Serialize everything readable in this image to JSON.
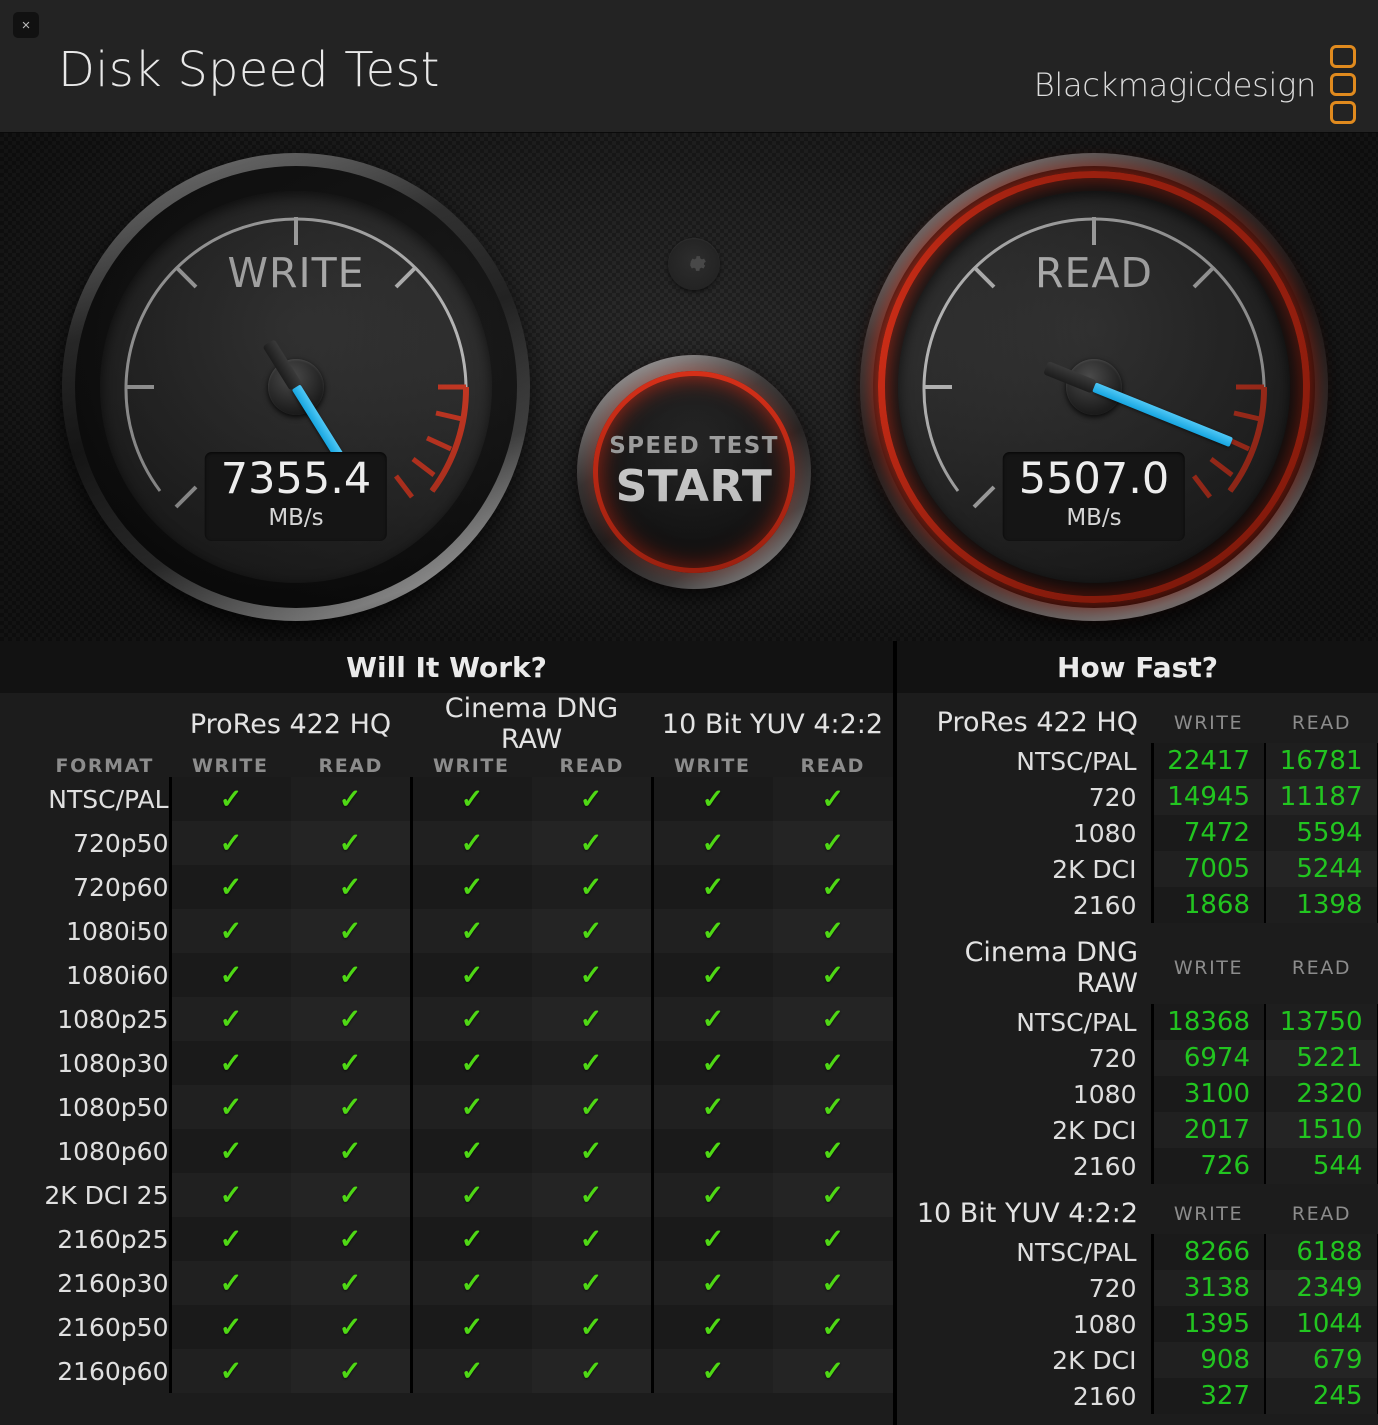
{
  "window": {
    "close_label": "×",
    "title": "Disk Speed Test",
    "brand": "Blackmagicdesign"
  },
  "gauges": {
    "write": {
      "label": "WRITE",
      "value": "7355.4",
      "unit": "MB/s",
      "angle_deg": 58
    },
    "read": {
      "label": "READ",
      "value": "5507.0",
      "unit": "MB/s",
      "angle_deg": 22
    },
    "start_button": {
      "line1": "SPEED TEST",
      "line2": "START"
    },
    "settings_icon": "gear-icon"
  },
  "will_it_work": {
    "title": "Will It Work?",
    "format_header": "FORMAT",
    "groups": [
      "ProRes 422 HQ",
      "Cinema DNG RAW",
      "10 Bit YUV 4:2:2"
    ],
    "sub_headers": [
      "WRITE",
      "READ"
    ],
    "check_glyph": "✓",
    "rows": [
      {
        "format": "NTSC/PAL",
        "results": [
          true,
          true,
          true,
          true,
          true,
          true
        ]
      },
      {
        "format": "720p50",
        "results": [
          true,
          true,
          true,
          true,
          true,
          true
        ]
      },
      {
        "format": "720p60",
        "results": [
          true,
          true,
          true,
          true,
          true,
          true
        ]
      },
      {
        "format": "1080i50",
        "results": [
          true,
          true,
          true,
          true,
          true,
          true
        ]
      },
      {
        "format": "1080i60",
        "results": [
          true,
          true,
          true,
          true,
          true,
          true
        ]
      },
      {
        "format": "1080p25",
        "results": [
          true,
          true,
          true,
          true,
          true,
          true
        ]
      },
      {
        "format": "1080p30",
        "results": [
          true,
          true,
          true,
          true,
          true,
          true
        ]
      },
      {
        "format": "1080p50",
        "results": [
          true,
          true,
          true,
          true,
          true,
          true
        ]
      },
      {
        "format": "1080p60",
        "results": [
          true,
          true,
          true,
          true,
          true,
          true
        ]
      },
      {
        "format": "2K DCI 25",
        "results": [
          true,
          true,
          true,
          true,
          true,
          true
        ]
      },
      {
        "format": "2160p25",
        "results": [
          true,
          true,
          true,
          true,
          true,
          true
        ]
      },
      {
        "format": "2160p30",
        "results": [
          true,
          true,
          true,
          true,
          true,
          true
        ]
      },
      {
        "format": "2160p50",
        "results": [
          true,
          true,
          true,
          true,
          true,
          true
        ]
      },
      {
        "format": "2160p60",
        "results": [
          true,
          true,
          true,
          true,
          true,
          true
        ]
      }
    ]
  },
  "how_fast": {
    "title": "How Fast?",
    "sub_headers": [
      "WRITE",
      "READ"
    ],
    "sections": [
      {
        "name": "ProRes 422 HQ",
        "rows": [
          {
            "label": "NTSC/PAL",
            "write": "22417",
            "read": "16781"
          },
          {
            "label": "720",
            "write": "14945",
            "read": "11187"
          },
          {
            "label": "1080",
            "write": "7472",
            "read": "5594"
          },
          {
            "label": "2K DCI",
            "write": "7005",
            "read": "5244"
          },
          {
            "label": "2160",
            "write": "1868",
            "read": "1398"
          }
        ]
      },
      {
        "name": "Cinema DNG RAW",
        "rows": [
          {
            "label": "NTSC/PAL",
            "write": "18368",
            "read": "13750"
          },
          {
            "label": "720",
            "write": "6974",
            "read": "5221"
          },
          {
            "label": "1080",
            "write": "3100",
            "read": "2320"
          },
          {
            "label": "2K DCI",
            "write": "2017",
            "read": "1510"
          },
          {
            "label": "2160",
            "write": "726",
            "read": "544"
          }
        ]
      },
      {
        "name": "10 Bit YUV 4:2:2",
        "rows": [
          {
            "label": "NTSC/PAL",
            "write": "8266",
            "read": "6188"
          },
          {
            "label": "720",
            "write": "3138",
            "read": "2349"
          },
          {
            "label": "1080",
            "write": "1395",
            "read": "1044"
          },
          {
            "label": "2K DCI",
            "write": "908",
            "read": "679"
          },
          {
            "label": "2160",
            "write": "327",
            "read": "245"
          }
        ]
      }
    ]
  },
  "colors": {
    "accent_green": "#4FD815",
    "value_green": "#22C520",
    "red_zone": "#e02b12",
    "needle_blue": "#29ABE2",
    "brand_orange": "#E08A1E"
  }
}
